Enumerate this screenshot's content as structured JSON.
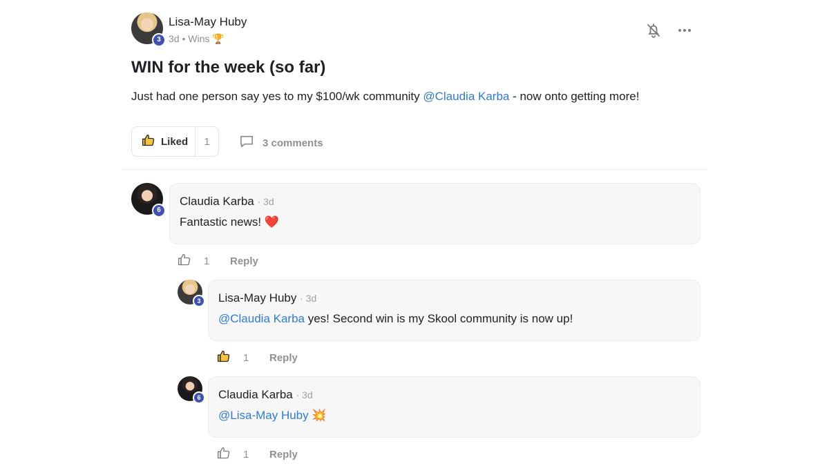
{
  "post": {
    "author": "Lisa-May Huby",
    "author_level": "3",
    "time": "3d",
    "separator": "•",
    "category": "Wins",
    "category_emoji": "🏆",
    "title": "WIN for the week (so far)",
    "body_before": "Just had one person say yes to my $100/wk community ",
    "body_mention": "@Claudia Karba",
    "body_after": " - now onto getting more!",
    "like_label": "Liked",
    "like_count": "1",
    "comments_label": "3 comments"
  },
  "comments": [
    {
      "author": "Claudia Karba",
      "level": "6",
      "time": "· 3d",
      "text": "Fantastic news! ",
      "emoji": "❤️",
      "likes": "1",
      "reply_label": "Reply",
      "liked": false
    },
    {
      "author": "Lisa-May Huby",
      "level": "3",
      "time": "· 3d",
      "mention": "@Claudia Karba",
      "text": " yes! Second win is my Skool community is now up!",
      "likes": "1",
      "reply_label": "Reply",
      "liked": true
    },
    {
      "author": "Claudia Karba",
      "level": "6",
      "time": "· 3d",
      "mention": "@Lisa-May Huby",
      "emoji": "💥",
      "likes": "1",
      "reply_label": "Reply",
      "liked": false
    }
  ],
  "colors": {
    "accent_link": "#2e7bd6",
    "level_badge": "#3f51b5",
    "liked_thumb": "#f5c542"
  },
  "icons": {
    "header_notify": "bell-off-icon",
    "header_more": "more-horizontal-icon",
    "like": "thumbs-up-icon",
    "comments": "comment-bubble-icon"
  }
}
